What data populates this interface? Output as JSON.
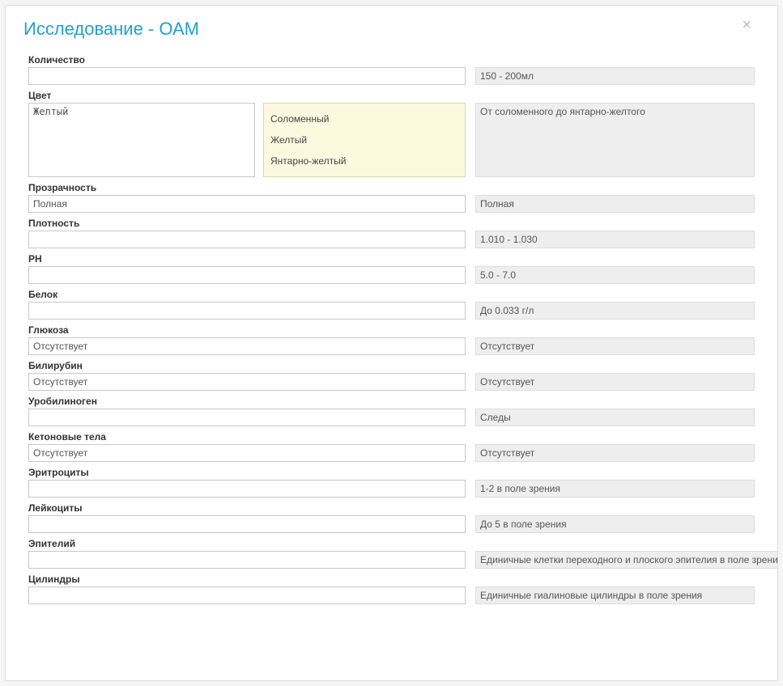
{
  "dialog": {
    "title": "Исследование - ОАМ",
    "close": "×"
  },
  "colorOptions": [
    "Соломенный",
    "Желтый",
    "Янтарно-желтый"
  ],
  "fields": {
    "quantity": {
      "label": "Количество",
      "value": "",
      "norm": "150 - 200мл"
    },
    "color": {
      "label": "Цвет",
      "value": "Желтый",
      "norm": "От соломенного до янтарно-желтого"
    },
    "clarity": {
      "label": "Прозрачность",
      "value": "Полная",
      "norm": "Полная"
    },
    "density": {
      "label": "Плотность",
      "value": "",
      "norm": "1.010 - 1.030"
    },
    "ph": {
      "label": "PH",
      "value": "",
      "norm": "5.0 - 7.0"
    },
    "protein": {
      "label": "Белок",
      "value": "",
      "norm": "До 0.033 г/л"
    },
    "glucose": {
      "label": "Глюкоза",
      "value": "Отсутствует",
      "norm": "Отсутствует"
    },
    "bilirubin": {
      "label": "Билирубин",
      "value": "Отсутствует",
      "norm": "Отсутствует"
    },
    "urobilinogen": {
      "label": "Уробилиноген",
      "value": "",
      "norm": "Следы"
    },
    "ketones": {
      "label": "Кетоновые тела",
      "value": "Отсутствует",
      "norm": "Отсутствует"
    },
    "erythrocytes": {
      "label": "Эритроциты",
      "value": "",
      "norm": "1-2 в поле зрения"
    },
    "leukocytes": {
      "label": "Лейкоциты",
      "value": "",
      "norm": "До 5 в поле зрения"
    },
    "epithelium": {
      "label": "Эпителий",
      "value": "",
      "norm": "Единичные клетки переходного и плоского эпителия в поле зрения"
    },
    "cylinders": {
      "label": "Цилиндры",
      "value": "",
      "norm": "Единичные гиалиновые цилиндры в поле зрения"
    }
  }
}
